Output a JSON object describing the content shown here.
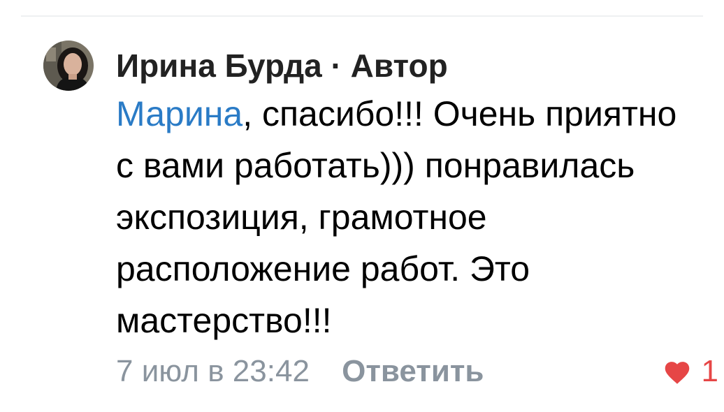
{
  "comment": {
    "author": "Ирина Бурда",
    "separator": "·",
    "role": "Автор",
    "mention": "Марина",
    "text": ", спасибо!!! Очень приятно с вами работать))) понравилась экспозиция, грамотное расположение работ. Это мастерство!!!",
    "date": "7 июл в 23:42",
    "reply_label": "Ответить",
    "like_count": "1",
    "liked": true,
    "avatar_icon": "user-avatar-photo",
    "like_icon": "heart-icon"
  },
  "colors": {
    "mention": "#2a7bc6",
    "meta_gray": "#8a949e",
    "like_red": "#e64646"
  }
}
